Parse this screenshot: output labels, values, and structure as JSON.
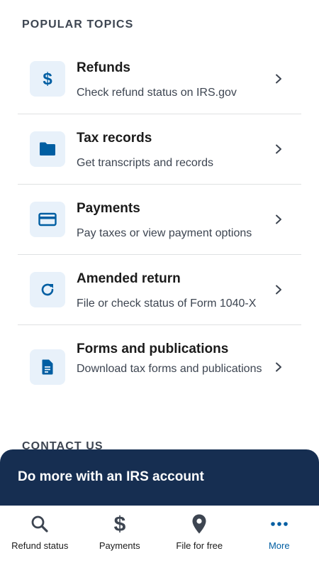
{
  "popular_topics": {
    "header": "POPULAR TOPICS",
    "items": [
      {
        "title": "Refunds",
        "description": "Check refund status on IRS.gov",
        "icon": "dollar-icon"
      },
      {
        "title": "Tax records",
        "description": "Get transcripts and records",
        "icon": "folder-icon"
      },
      {
        "title": "Payments",
        "description": "Pay taxes or view payment options",
        "icon": "credit-card-icon"
      },
      {
        "title": "Amended return",
        "description": "File or check status of Form 1040-X",
        "icon": "refresh-icon"
      },
      {
        "title": "Forms and publications",
        "description": "Download tax forms and publications",
        "icon": "document-icon"
      }
    ]
  },
  "contact_us": {
    "header": "CONTACT US"
  },
  "account_banner": {
    "text": "Do more with an IRS account"
  },
  "bottom_nav": {
    "items": [
      {
        "label": "Refund status",
        "icon": "search-icon"
      },
      {
        "label": "Payments",
        "icon": "dollar-icon"
      },
      {
        "label": "File for free",
        "icon": "map-pin-icon"
      },
      {
        "label": "More",
        "icon": "more-dots-icon",
        "active": true
      }
    ]
  },
  "colors": {
    "accent": "#005ea2",
    "icon_tile_bg": "#e8f1fa",
    "banner_bg": "#162e51",
    "divider": "#dfe1e2"
  }
}
